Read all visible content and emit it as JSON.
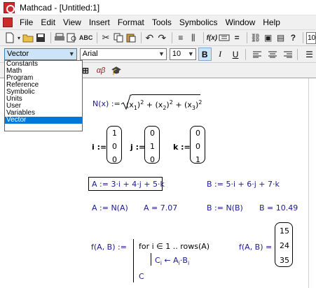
{
  "titlebar": {
    "title": "Mathcad - [Untitled:1]"
  },
  "menubar": {
    "items": [
      "File",
      "Edit",
      "View",
      "Insert",
      "Format",
      "Tools",
      "Symbolics",
      "Window",
      "Help"
    ]
  },
  "toolbar": {
    "icons": [
      "new-document-icon",
      "open-icon",
      "save-icon",
      "print-icon",
      "print-preview-icon",
      "spellcheck-icon",
      "cut-icon",
      "copy-icon",
      "paste-icon",
      "undo-icon",
      "redo-icon",
      "insert-function-icon",
      "insert-unit-icon"
    ],
    "function_label": "f(x)",
    "right_value": "10"
  },
  "format_toolbar": {
    "style_value": "Vector",
    "font_value": "Arial",
    "size_value": "10",
    "bold": "B",
    "italic": "I",
    "underline": "U"
  },
  "math_toolbar": {
    "greek_label": "αβ"
  },
  "style_dropdown": {
    "options": [
      "Constants",
      "Math",
      "Program",
      "Reference",
      "Symbolic",
      "Units",
      "User",
      "Variables",
      "Vector"
    ],
    "selected": "Vector"
  },
  "worksheet": {
    "norm_def": {
      "lhs": "N(x) :=",
      "term1": "(x",
      "sub1": "1",
      "term2": ")",
      "sup": "2",
      "plus": "+",
      "term3": "(x",
      "sub2": "2",
      "sub3": "3"
    },
    "unit_vectors": {
      "i_label": "i :=",
      "j_label": "j :=",
      "k_label": "k :=",
      "i": [
        "1",
        "0",
        "0"
      ],
      "j": [
        "0",
        "1",
        "0"
      ],
      "k": [
        "0",
        "0",
        "1"
      ]
    },
    "A_def": "A := 3·i + 4·j + 5·k",
    "B_def": "B := 5·i + 6·j + 7·k",
    "A_norm_def": "A := N(A)",
    "A_norm_value": "A = 7.07",
    "B_norm_def": "B := N(B)",
    "B_norm_value": "B = 10.49",
    "func_def": "f(A, B) :=",
    "prog_line1": "for   i ∈ 1 .. rows(A)",
    "prog_line2": "C",
    "prog_line2_rest": " ← A",
    "prog_line2_sub": "i",
    "prog_line2_b": "·B",
    "prog_line3": "C",
    "func_eval": "f(A, B) =",
    "result": [
      "15",
      "24",
      "35"
    ]
  }
}
